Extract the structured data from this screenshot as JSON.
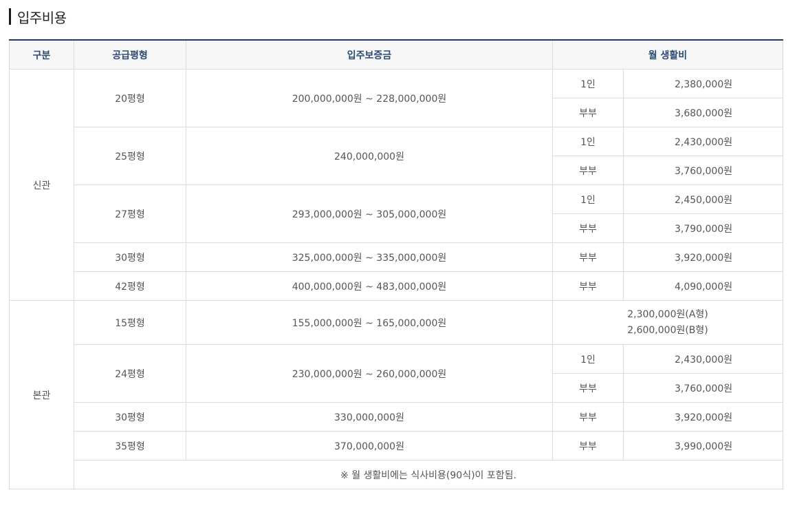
{
  "title": "입주비용",
  "headers": {
    "category": "구분",
    "size": "공급평형",
    "deposit": "입주보증금",
    "monthly": "월 생활비"
  },
  "sections": [
    {
      "name": "신관",
      "rows": [
        {
          "size": "20평형",
          "deposit": "200,000,000원 ~ 228,000,000원",
          "fees": [
            {
              "type": "1인",
              "amount": "2,380,000원"
            },
            {
              "type": "부부",
              "amount": "3,680,000원"
            }
          ]
        },
        {
          "size": "25평형",
          "deposit": "240,000,000원",
          "fees": [
            {
              "type": "1인",
              "amount": "2,430,000원"
            },
            {
              "type": "부부",
              "amount": "3,760,000원"
            }
          ]
        },
        {
          "size": "27평형",
          "deposit": "293,000,000원 ~ 305,000,000원",
          "fees": [
            {
              "type": "1인",
              "amount": "2,450,000원"
            },
            {
              "type": "부부",
              "amount": "3,790,000원"
            }
          ]
        },
        {
          "size": "30평형",
          "deposit": "325,000,000원 ~ 335,000,000원",
          "fees": [
            {
              "type": "부부",
              "amount": "3,920,000원"
            }
          ]
        },
        {
          "size": "42평형",
          "deposit": "400,000,000원 ~ 483,000,000원",
          "fees": [
            {
              "type": "부부",
              "amount": "4,090,000원"
            }
          ]
        }
      ]
    },
    {
      "name": "본관",
      "rows": [
        {
          "size": "15평형",
          "deposit": "155,000,000원 ~ 165,000,000원",
          "merged_fees": [
            "2,300,000원(A형)",
            "2,600,000원(B형)"
          ]
        },
        {
          "size": "24평형",
          "deposit": "230,000,000원 ~ 260,000,000원",
          "fees": [
            {
              "type": "1인",
              "amount": "2,430,000원"
            },
            {
              "type": "부부",
              "amount": "3,760,000원"
            }
          ]
        },
        {
          "size": "30평형",
          "deposit": "330,000,000원",
          "fees": [
            {
              "type": "부부",
              "amount": "3,920,000원"
            }
          ]
        },
        {
          "size": "35평형",
          "deposit": "370,000,000원",
          "fees": [
            {
              "type": "부부",
              "amount": "3,990,000원"
            }
          ]
        }
      ]
    }
  ],
  "note": "※ 월 생활비에는 식사비용(90식)이 포함됨."
}
